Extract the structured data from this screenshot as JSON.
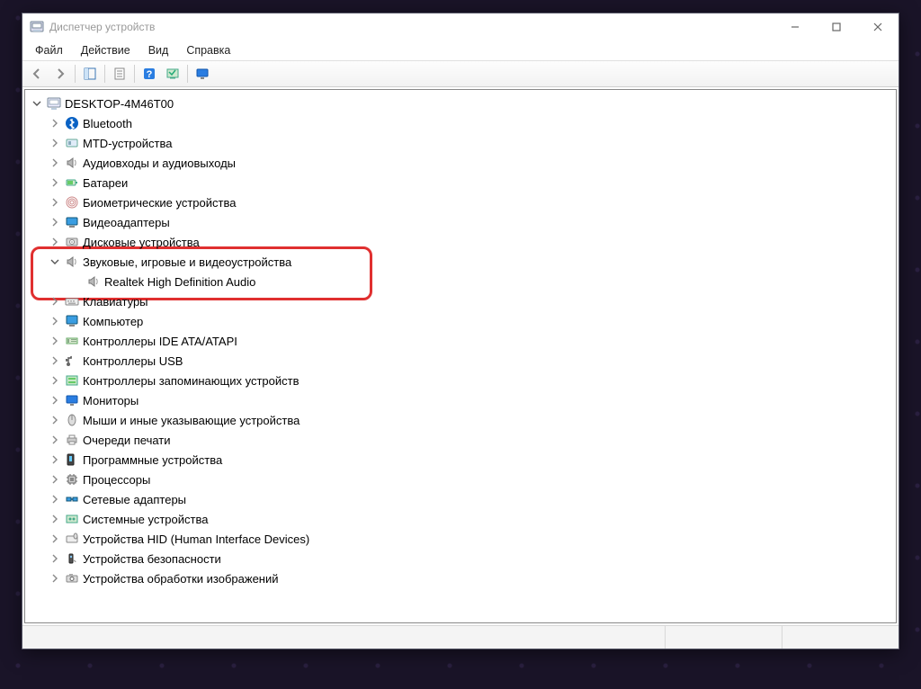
{
  "window": {
    "title": "Диспетчер устройств"
  },
  "menu": {
    "file": "Файл",
    "action": "Действие",
    "view": "Вид",
    "help": "Справка"
  },
  "root": {
    "name": "DESKTOP-4M46T00"
  },
  "categories": [
    {
      "label": "Bluetooth",
      "icon": "bluetooth"
    },
    {
      "label": "MTD-устройства",
      "icon": "mtd"
    },
    {
      "label": "Аудиовходы и аудиовыходы",
      "icon": "speaker"
    },
    {
      "label": "Батареи",
      "icon": "battery"
    },
    {
      "label": "Биометрические устройства",
      "icon": "fingerprint"
    },
    {
      "label": "Видеоадаптеры",
      "icon": "display-adapter"
    },
    {
      "label": "Дисковые устройства",
      "icon": "disk"
    },
    {
      "label": "Звуковые, игровые и видеоустройства",
      "icon": "speaker",
      "expanded": true,
      "children": [
        {
          "label": "Realtek High Definition Audio",
          "icon": "speaker"
        }
      ]
    },
    {
      "label": "Клавиатуры",
      "icon": "keyboard"
    },
    {
      "label": "Компьютер",
      "icon": "computer"
    },
    {
      "label": "Контроллеры IDE ATA/ATAPI",
      "icon": "ide"
    },
    {
      "label": "Контроллеры USB",
      "icon": "usb"
    },
    {
      "label": "Контроллеры запоминающих устройств",
      "icon": "storage-ctrl"
    },
    {
      "label": "Мониторы",
      "icon": "monitor"
    },
    {
      "label": "Мыши и иные указывающие устройства",
      "icon": "mouse"
    },
    {
      "label": "Очереди печати",
      "icon": "printer"
    },
    {
      "label": "Программные устройства",
      "icon": "software"
    },
    {
      "label": "Процессоры",
      "icon": "cpu"
    },
    {
      "label": "Сетевые адаптеры",
      "icon": "network"
    },
    {
      "label": "Системные устройства",
      "icon": "system"
    },
    {
      "label": "Устройства HID (Human Interface Devices)",
      "icon": "hid"
    },
    {
      "label": "Устройства безопасности",
      "icon": "security"
    },
    {
      "label": "Устройства обработки изображений",
      "icon": "imaging"
    }
  ]
}
